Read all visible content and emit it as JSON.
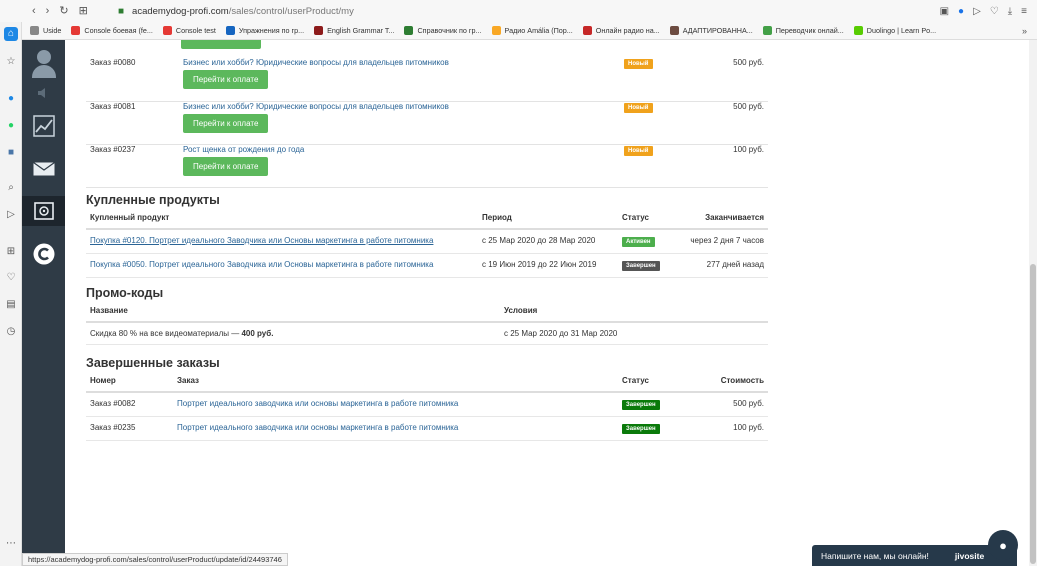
{
  "browser": {
    "url_domain": "academydog-profi.com",
    "url_path": "/sales/control/userProduct/my",
    "bookmarks": [
      {
        "label": "Uside",
        "color": "#888888"
      },
      {
        "label": "Console боевая (fe...",
        "color": "#e53935"
      },
      {
        "label": "Console test",
        "color": "#e53935"
      },
      {
        "label": "Упражнения по гр...",
        "color": "#1565c0"
      },
      {
        "label": "English Grammar T...",
        "color": "#8d1b1b"
      },
      {
        "label": "Справочник по гр...",
        "color": "#2e7d32"
      },
      {
        "label": "Радио Amália (Пор...",
        "color": "#f9a825"
      },
      {
        "label": "Онлайн радио на...",
        "color": "#c62828"
      },
      {
        "label": "АДАПТИРОВАННА...",
        "color": "#6d4c41"
      },
      {
        "label": "Переводчик онлай...",
        "color": "#43a047"
      },
      {
        "label": "Duolingo | Learn Po...",
        "color": "#58cc02"
      }
    ],
    "status_url": "https://academydog-profi.com/sales/control/userProduct/update/id/24493746"
  },
  "orders_unpaid": [
    {
      "number": "Заказ #0080",
      "product": "Бизнес или хобби? Юридические вопросы для владельцев питомников",
      "button": "Перейти к оплате",
      "status": "Новый",
      "price": "500 руб."
    },
    {
      "number": "Заказ #0081",
      "product": "Бизнес или хобби? Юридические вопросы для владельцев питомников",
      "button": "Перейти к оплате",
      "status": "Новый",
      "price": "500 руб."
    },
    {
      "number": "Заказ #0237",
      "product": "Рост щенка от рождения до года",
      "button": "Перейти к оплате",
      "status": "Новый",
      "price": "100 руб."
    }
  ],
  "purchased": {
    "title": "Купленные продукты",
    "headers": {
      "product": "Купленный продукт",
      "period": "Период",
      "status": "Статус",
      "ends": "Заканчивается"
    },
    "rows": [
      {
        "product": "Покупка #0120. Портрет идеального Заводчика или Основы маркетинга в работе питомника",
        "period": "с 25 Мар 2020 до 28 Мар 2020",
        "status": "Активен",
        "ends": "через 2 дня 7 часов"
      },
      {
        "product": "Покупка #0050. Портрет идеального Заводчика или Основы маркетинга в работе питомника",
        "period": "с 19 Июн 2019 до 22 Июн 2019",
        "status": "Завершен",
        "ends": "277 дней назад"
      }
    ]
  },
  "promo": {
    "title": "Промо-коды",
    "headers": {
      "name": "Название",
      "conditions": "Условия"
    },
    "rows": [
      {
        "name_prefix": "Скидка 80 % на все видеоматериалы — ",
        "name_bold": "400 руб.",
        "conditions": "с 25 Мар 2020 до 31 Мар 2020"
      }
    ]
  },
  "completed": {
    "title": "Завершенные заказы",
    "headers": {
      "number": "Номер",
      "order": "Заказ",
      "status": "Статус",
      "cost": "Стоимость"
    },
    "rows": [
      {
        "number": "Заказ #0082",
        "order": "Портрет идеального заводчика или основы маркетинга в работе питомника",
        "status": "Завершен",
        "cost": "500 руб."
      },
      {
        "number": "Заказ #0235",
        "order": "Портрет идеального заводчика или основы маркетинга в работе питомника",
        "status": "Завершен",
        "cost": "100 руб."
      }
    ]
  },
  "chat": {
    "text": "Напишите нам, мы онлайн!",
    "logo": "jivosite"
  }
}
